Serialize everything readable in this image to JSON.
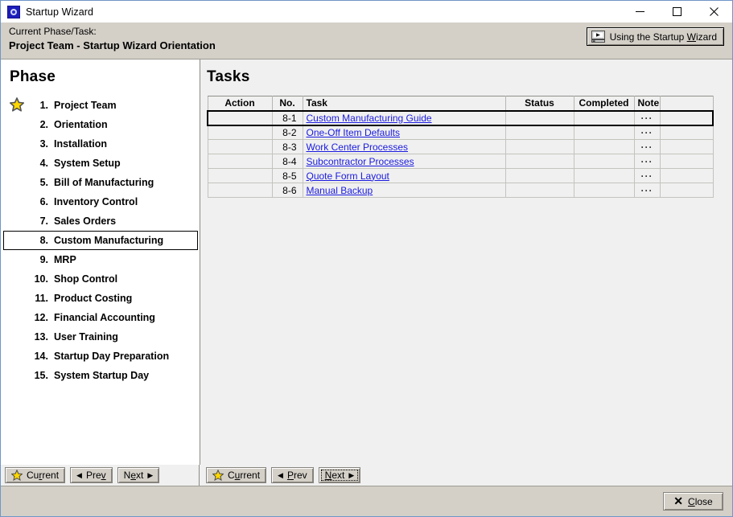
{
  "window": {
    "title": "Startup Wizard",
    "icon": "app-wizard-icon",
    "minimize_label": "–",
    "maximize_label": "□",
    "close_label": "✕"
  },
  "header": {
    "current_label": "Current Phase/Task:",
    "current_value": "Project Team - Startup Wizard Orientation",
    "wizard_button": {
      "text_before": "Using the Startup ",
      "accesskey": "W",
      "text_after": "izard",
      "icon": "video-play-icon"
    }
  },
  "phase_panel": {
    "title": "Phase",
    "selected_index": 7,
    "current_index": 0,
    "items": [
      {
        "num": "1.",
        "label": "Project Team"
      },
      {
        "num": "2.",
        "label": "Orientation"
      },
      {
        "num": "3.",
        "label": "Installation"
      },
      {
        "num": "4.",
        "label": "System Setup"
      },
      {
        "num": "5.",
        "label": "Bill of Manufacturing"
      },
      {
        "num": "6.",
        "label": "Inventory Control"
      },
      {
        "num": "7.",
        "label": "Sales Orders"
      },
      {
        "num": "8.",
        "label": "Custom Manufacturing"
      },
      {
        "num": "9.",
        "label": "MRP"
      },
      {
        "num": "10.",
        "label": "Shop Control"
      },
      {
        "num": "11.",
        "label": "Product Costing"
      },
      {
        "num": "12.",
        "label": "Financial Accounting"
      },
      {
        "num": "13.",
        "label": "User Training"
      },
      {
        "num": "14.",
        "label": "Startup Day Preparation"
      },
      {
        "num": "15.",
        "label": "System Startup Day"
      }
    ]
  },
  "tasks_panel": {
    "title": "Tasks",
    "columns": [
      "Action",
      "No.",
      "Task",
      "Status",
      "Completed",
      "Note",
      ""
    ],
    "selected_row": 0,
    "rows": [
      {
        "action": "",
        "no": "8-1",
        "task": "Custom Manufacturing Guide",
        "status": "",
        "completed": "",
        "note": "···",
        "extra": ""
      },
      {
        "action": "",
        "no": "8-2",
        "task": "One-Off Item Defaults",
        "status": "",
        "completed": "",
        "note": "···",
        "extra": ""
      },
      {
        "action": "",
        "no": "8-3",
        "task": "Work Center Processes",
        "status": "",
        "completed": "",
        "note": "···",
        "extra": ""
      },
      {
        "action": "",
        "no": "8-4",
        "task": "Subcontractor Processes",
        "status": "",
        "completed": "",
        "note": "···",
        "extra": ""
      },
      {
        "action": "",
        "no": "8-5",
        "task": "Quote Form Layout",
        "status": "",
        "completed": "",
        "note": "···",
        "extra": ""
      },
      {
        "action": "",
        "no": "8-6",
        "task": "Manual Backup",
        "status": "",
        "completed": "",
        "note": "···",
        "extra": ""
      }
    ]
  },
  "phase_nav": {
    "current": {
      "before": "Cu",
      "accesskey": "r",
      "after": "rent",
      "icon": "star-icon"
    },
    "prev": {
      "before": "Pre",
      "accesskey": "v",
      "after": "",
      "icon": "triangle-left-icon"
    },
    "next": {
      "before": "N",
      "accesskey": "e",
      "after": "xt",
      "icon": "triangle-right-icon"
    }
  },
  "task_nav": {
    "current": {
      "before": "C",
      "accesskey": "u",
      "after": "rrent",
      "icon": "star-icon"
    },
    "prev": {
      "before": "",
      "accesskey": "P",
      "after": "rev",
      "icon": "triangle-left-icon"
    },
    "next": {
      "before": "",
      "accesskey": "N",
      "after": "ext",
      "icon": "triangle-right-icon",
      "focused": true
    }
  },
  "footer": {
    "close": {
      "before": "",
      "accesskey": "C",
      "after": "lose",
      "icon": "x-icon"
    }
  },
  "colors": {
    "chrome": "#d4d0c8",
    "panel_white": "#ffffff",
    "panel_gray": "#f0f0f0",
    "link": "#1a1ae0",
    "star_fill": "#ffd700",
    "window_border": "#6f96c8"
  }
}
